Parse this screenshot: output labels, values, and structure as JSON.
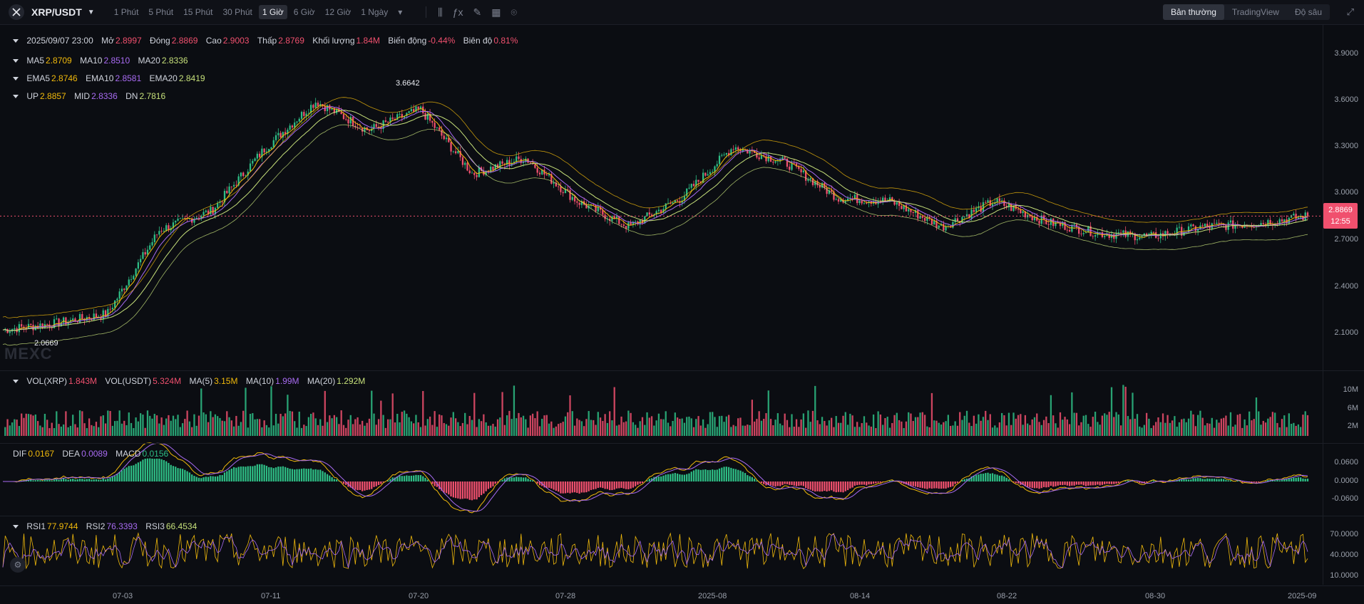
{
  "header": {
    "pair": "XRP/USDT",
    "timeframes": [
      "1 Phút",
      "5 Phút",
      "15 Phút",
      "30 Phút",
      "1 Giờ",
      "6 Giờ",
      "12 Giờ",
      "1 Ngày"
    ],
    "active_timeframe": "1 Giờ",
    "views": [
      "Bản thường",
      "TradingView",
      "Độ sâu"
    ],
    "active_view": "Bản thường"
  },
  "ohlc": {
    "date_label": "2025/09/07 23:00",
    "open_label": "Mở",
    "open": "2.8997",
    "close_label": "Đóng",
    "close": "2.8869",
    "high_label": "Cao",
    "high": "2.9003",
    "low_label": "Thấp",
    "low": "2.8769",
    "volume_label": "Khối lượng",
    "volume": "1.84M",
    "change_label": "Biến động",
    "change": "-0.44%",
    "amplitude_label": "Biên độ",
    "amplitude": "0.81%"
  },
  "ma": {
    "ma5_label": "MA5",
    "ma5": "2.8709",
    "ma10_label": "MA10",
    "ma10": "2.8510",
    "ma20_label": "MA20",
    "ma20": "2.8336"
  },
  "ema": {
    "ema5_label": "EMA5",
    "ema5": "2.8746",
    "ema10_label": "EMA10",
    "ema10": "2.8581",
    "ema20_label": "EMA20",
    "ema20": "2.8419"
  },
  "boll": {
    "up_label": "UP",
    "up": "2.8857",
    "mid_label": "MID",
    "mid": "2.8336",
    "dn_label": "DN",
    "dn": "2.7816"
  },
  "vol": {
    "vol_xrp_label": "VOL(XRP)",
    "vol_xrp": "1.843M",
    "vol_usdt_label": "VOL(USDT)",
    "vol_usdt": "5.324M",
    "ma5_label": "MA(5)",
    "ma5": "3.15M",
    "ma10_label": "MA(10)",
    "ma10": "1.99M",
    "ma20_label": "MA(20)",
    "ma20": "1.292M"
  },
  "macd": {
    "dif_label": "DIF",
    "dif": "0.0167",
    "dea_label": "DEA",
    "dea": "0.0089",
    "macd_label": "MACD",
    "macd": "0.0156"
  },
  "rsi": {
    "rsi1_label": "RSI1",
    "rsi1": "77.9744",
    "rsi2_label": "RSI2",
    "rsi2": "76.3393",
    "rsi3_label": "RSI3",
    "rsi3": "66.4534"
  },
  "price_axis": [
    "3.9000",
    "3.6000",
    "3.3000",
    "3.0000",
    "2.7000",
    "2.4000",
    "2.1000"
  ],
  "vol_axis": [
    "10M",
    "6M",
    "2M"
  ],
  "macd_axis": [
    "0.0600",
    "0.0000",
    "-0.0600"
  ],
  "rsi_axis": [
    "70.0000",
    "40.0000",
    "10.0000"
  ],
  "dates": [
    "07-03",
    "07-11",
    "07-20",
    "07-28",
    "2025-08",
    "08-14",
    "08-22",
    "08-30",
    "2025-09"
  ],
  "last_price": "2.8869",
  "countdown": "12:55",
  "high_marker": "3.6642",
  "low_marker": "2.0669",
  "watermark": "MEXC",
  "colors": {
    "up": "#2ebd85",
    "down": "#f0506e",
    "ma5": "#f0b90b",
    "ma10": "#a86bf2",
    "ma20": "#c6e07a"
  },
  "chart_data": {
    "type": "candlestick",
    "x": [
      "2025-06-29",
      "2025-07-03",
      "2025-07-07",
      "2025-07-11",
      "2025-07-14",
      "2025-07-17",
      "2025-07-18",
      "2025-07-20",
      "2025-07-23",
      "2025-07-26",
      "2025-07-28",
      "2025-07-31",
      "2025-08-03",
      "2025-08-06",
      "2025-08-08",
      "2025-08-11",
      "2025-08-14",
      "2025-08-17",
      "2025-08-20",
      "2025-08-22",
      "2025-08-25",
      "2025-08-28",
      "2025-08-30",
      "2025-09-02",
      "2025-09-05",
      "2025-09-07"
    ],
    "close": [
      2.18,
      2.22,
      2.28,
      2.8,
      2.92,
      3.3,
      3.6,
      3.42,
      3.55,
      3.15,
      3.25,
      2.98,
      2.82,
      3.0,
      3.32,
      3.22,
      3.0,
      2.98,
      2.82,
      2.98,
      2.85,
      2.78,
      2.76,
      2.82,
      2.84,
      2.8869
    ],
    "ylim": [
      1.95,
      4.0
    ],
    "high_marker": 3.6642,
    "low_marker": 2.0669
  }
}
